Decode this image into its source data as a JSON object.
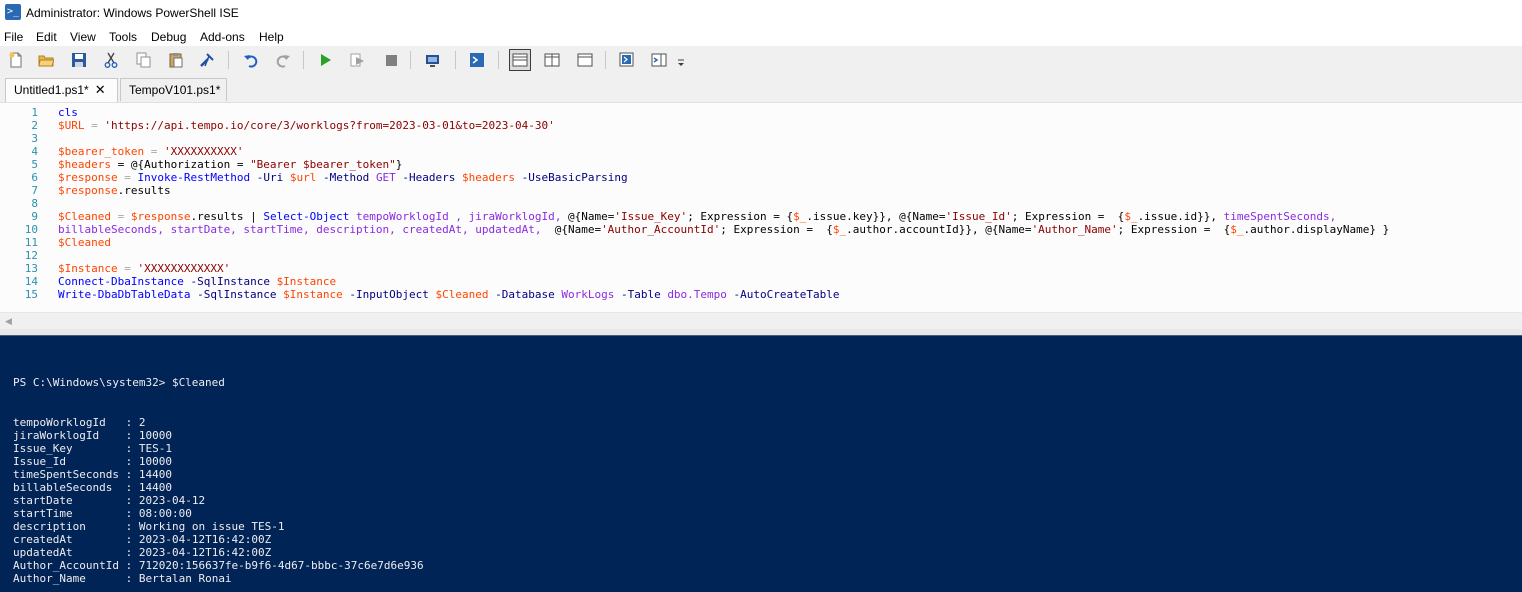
{
  "window": {
    "title": "Administrator: Windows PowerShell ISE"
  },
  "menu": [
    "File",
    "Edit",
    "View",
    "Tools",
    "Debug",
    "Add-ons",
    "Help"
  ],
  "toolbar": {
    "icons": [
      "new-file-icon",
      "open-folder-icon",
      "save-icon",
      "cut-icon",
      "copy-icon",
      "paste-icon",
      "clear-console-icon",
      "undo-icon",
      "redo-icon",
      "run-script-icon",
      "run-selection-icon",
      "stop-icon",
      "new-remote-tab-icon",
      "start-powershell-icon",
      "show-script-top-icon",
      "show-script-right-icon",
      "show-script-maximized-icon",
      "show-command-window-icon",
      "show-command-addon-icon",
      "toolbar-overflow-icon"
    ]
  },
  "tabs": [
    {
      "label": "Untitled1.ps1*",
      "close": "✕",
      "active": true
    },
    {
      "label": "TempoV101.ps1*",
      "active": false
    }
  ],
  "editor": {
    "line_numbers": [
      "1",
      "2",
      "3",
      "4",
      "5",
      "6",
      "7",
      "8",
      "9",
      "10",
      "11",
      "12",
      "13",
      "14",
      "15"
    ],
    "lines": [
      [
        {
          "t": "cls",
          "c": "cmd"
        }
      ],
      [
        {
          "t": "$URL",
          "c": "var"
        },
        {
          "t": " = ",
          "c": "op"
        },
        {
          "t": "'https://api.tempo.io/core/3/worklogs?from=2023-03-01&to=2023-04-30'",
          "c": "str"
        }
      ],
      [],
      [
        {
          "t": "$bearer_token",
          "c": "var"
        },
        {
          "t": " = ",
          "c": "op"
        },
        {
          "t": "'XXXXXXXXXX'",
          "c": "str"
        }
      ],
      [
        {
          "t": "$headers",
          "c": "var"
        },
        {
          "t": " = @{Authorization = ",
          "c": ""
        },
        {
          "t": "\"Bearer $bearer_token\"",
          "c": "str"
        },
        {
          "t": "}",
          "c": ""
        }
      ],
      [
        {
          "t": "$response",
          "c": "var"
        },
        {
          "t": " = ",
          "c": "op"
        },
        {
          "t": "Invoke-RestMethod",
          "c": "cmd"
        },
        {
          "t": " -Uri ",
          "c": "param"
        },
        {
          "t": "$url",
          "c": "var"
        },
        {
          "t": " -Method ",
          "c": "param"
        },
        {
          "t": "GET",
          "c": "typ"
        },
        {
          "t": " -Headers ",
          "c": "param"
        },
        {
          "t": "$headers",
          "c": "var"
        },
        {
          "t": " -UseBasicParsing",
          "c": "param"
        }
      ],
      [
        {
          "t": "$response",
          "c": "var"
        },
        {
          "t": ".results",
          "c": ""
        }
      ],
      [],
      [
        {
          "t": "$Cleaned",
          "c": "var"
        },
        {
          "t": " = ",
          "c": "op"
        },
        {
          "t": "$response",
          "c": "var"
        },
        {
          "t": ".results | ",
          "c": ""
        },
        {
          "t": "Select-Object",
          "c": "cmd"
        },
        {
          "t": " tempoWorklogId , jiraWorklogId, ",
          "c": "typ"
        },
        {
          "t": "@{Name=",
          "c": ""
        },
        {
          "t": "'Issue_Key'",
          "c": "str"
        },
        {
          "t": "; Expression = {",
          "c": ""
        },
        {
          "t": "$_",
          "c": "var"
        },
        {
          "t": ".issue.key}}, @{Name=",
          "c": ""
        },
        {
          "t": "'Issue_Id'",
          "c": "str"
        },
        {
          "t": "; Expression =  {",
          "c": ""
        },
        {
          "t": "$_",
          "c": "var"
        },
        {
          "t": ".issue.id}}, ",
          "c": ""
        },
        {
          "t": "timeSpentSeconds,",
          "c": "typ"
        }
      ],
      [
        {
          "t": "billableSeconds, startDate, startTime, description, createdAt, updatedAt,  ",
          "c": "typ"
        },
        {
          "t": "@{Name=",
          "c": ""
        },
        {
          "t": "'Author_AccountId'",
          "c": "str"
        },
        {
          "t": "; Expression =  {",
          "c": ""
        },
        {
          "t": "$_",
          "c": "var"
        },
        {
          "t": ".author.accountId}}, @{Name=",
          "c": ""
        },
        {
          "t": "'Author_Name'",
          "c": "str"
        },
        {
          "t": "; Expression =  {",
          "c": ""
        },
        {
          "t": "$_",
          "c": "var"
        },
        {
          "t": ".author.displayName} }",
          "c": ""
        }
      ],
      [
        {
          "t": "$Cleaned",
          "c": "var"
        }
      ],
      [],
      [
        {
          "t": "$Instance",
          "c": "var"
        },
        {
          "t": " = ",
          "c": "op"
        },
        {
          "t": "'XXXXXXXXXXXX'",
          "c": "str"
        }
      ],
      [
        {
          "t": "Connect-DbaInstance",
          "c": "cmd"
        },
        {
          "t": " -SqlInstance ",
          "c": "param"
        },
        {
          "t": "$Instance",
          "c": "var"
        }
      ],
      [
        {
          "t": "Write-DbaDbTableData",
          "c": "cmd"
        },
        {
          "t": " -SqlInstance ",
          "c": "param"
        },
        {
          "t": "$Instance",
          "c": "var"
        },
        {
          "t": " -InputObject ",
          "c": "param"
        },
        {
          "t": "$Cleaned",
          "c": "var"
        },
        {
          "t": " -Database ",
          "c": "param"
        },
        {
          "t": "WorkLogs",
          "c": "typ"
        },
        {
          "t": " -Table ",
          "c": "param"
        },
        {
          "t": "dbo.Tempo",
          "c": "typ"
        },
        {
          "t": " -AutoCreateTable",
          "c": "param"
        }
      ]
    ]
  },
  "console": {
    "prompt": "PS C:\\Windows\\system32> $Cleaned",
    "rows": [
      {
        "key": "tempoWorklogId  ",
        "value": "2"
      },
      {
        "key": "jiraWorklogId   ",
        "value": "10000"
      },
      {
        "key": "Issue_Key       ",
        "value": "TES-1"
      },
      {
        "key": "Issue_Id        ",
        "value": "10000"
      },
      {
        "key": "timeSpentSeconds",
        "value": "14400"
      },
      {
        "key": "billableSeconds ",
        "value": "14400"
      },
      {
        "key": "startDate       ",
        "value": "2023-04-12"
      },
      {
        "key": "startTime       ",
        "value": "08:00:00"
      },
      {
        "key": "description     ",
        "value": "Working on issue TES-1"
      },
      {
        "key": "createdAt       ",
        "value": "2023-04-12T16:42:00Z"
      },
      {
        "key": "updatedAt       ",
        "value": "2023-04-12T16:42:00Z"
      },
      {
        "key": "Author_AccountId",
        "value": "712020:156637fe-b9f6-4d67-bbbc-37c6e7d6e936"
      },
      {
        "key": "Author_Name     ",
        "value": "Bertalan Ronai"
      }
    ]
  },
  "colors": {
    "console_bg": "#012456",
    "console_fg": "#eeedf0",
    "editor_bg": "#fcfcfc"
  }
}
